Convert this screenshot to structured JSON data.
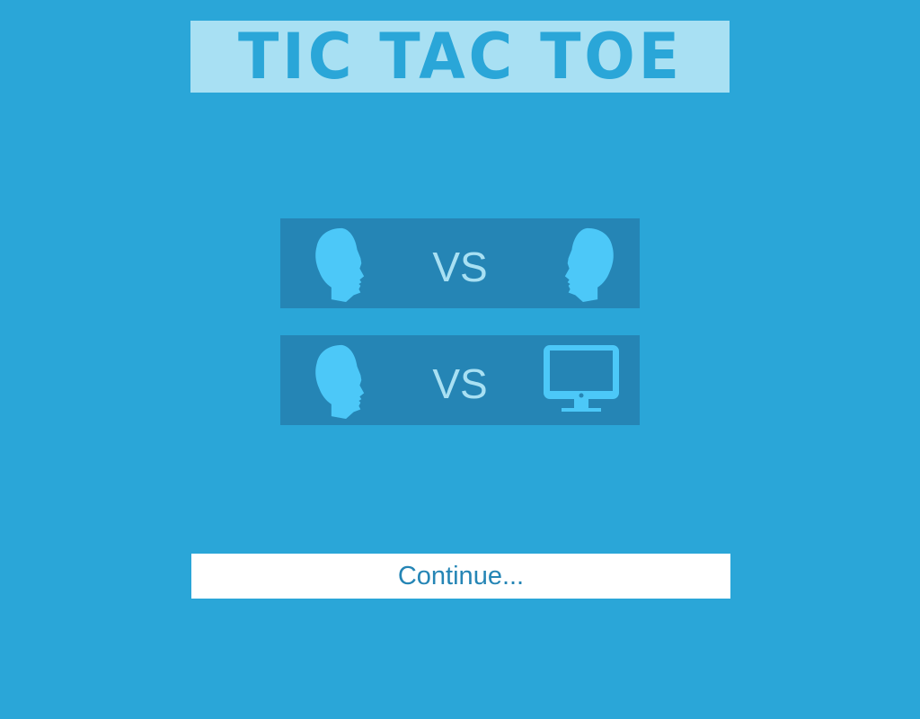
{
  "title": "TIC TAC TOE",
  "menu": {
    "modes": [
      {
        "left_icon": "human-head-icon",
        "vs_label": "VS",
        "right_icon": "human-head-icon"
      },
      {
        "left_icon": "human-head-icon",
        "vs_label": "VS",
        "right_icon": "computer-monitor-icon"
      }
    ],
    "continue_label": "Continue..."
  },
  "colors": {
    "background": "#2aa6d8",
    "title_banner": "#a8e0f3",
    "mode_button": "#2585b5",
    "icon": "#4cc8f8",
    "vs_text": "#a8e0f3",
    "continue_bg": "#ffffff",
    "continue_text": "#2585b5"
  }
}
